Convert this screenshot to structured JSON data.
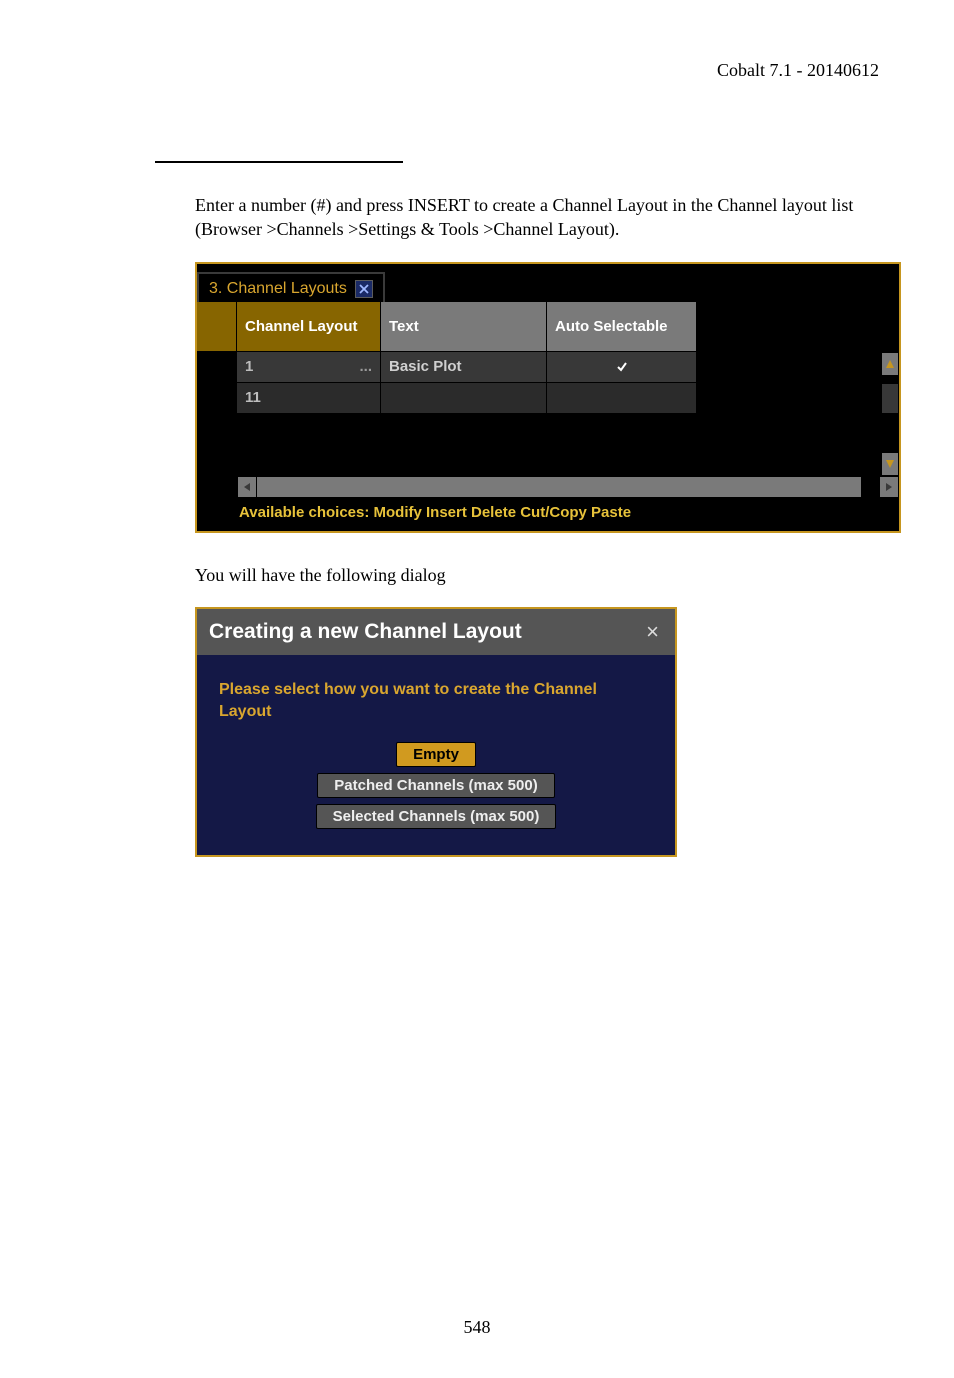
{
  "header": {
    "product_version": "Cobalt 7.1 - 20140612"
  },
  "intro_text": "Enter a number (#) and press INSERT to create a Channel Layout in the Channel layout list (Browser >Channels >Settings & Tools >Channel Layout).",
  "shot1": {
    "tab_label": "3. Channel Layouts",
    "columns": {
      "col1": "Channel Layout",
      "col2": "Text",
      "col3": "Auto Selectable"
    },
    "rows": [
      {
        "id": "1",
        "dots": "...",
        "text": "Basic Plot",
        "checked": true
      },
      {
        "id": "11",
        "dots": "",
        "text": "",
        "checked": false
      }
    ],
    "footer_hint": "Available choices: Modify Insert Delete Cut/Copy Paste"
  },
  "mid_text": "You will have the following dialog",
  "shot2": {
    "title": "Creating a new Channel Layout",
    "prompt": "Please select how you want to create the Channel Layout",
    "options": {
      "empty": "Empty",
      "patched": "Patched Channels (max 500)",
      "selected": "Selected Channels (max 500)"
    }
  },
  "page_number": "548"
}
